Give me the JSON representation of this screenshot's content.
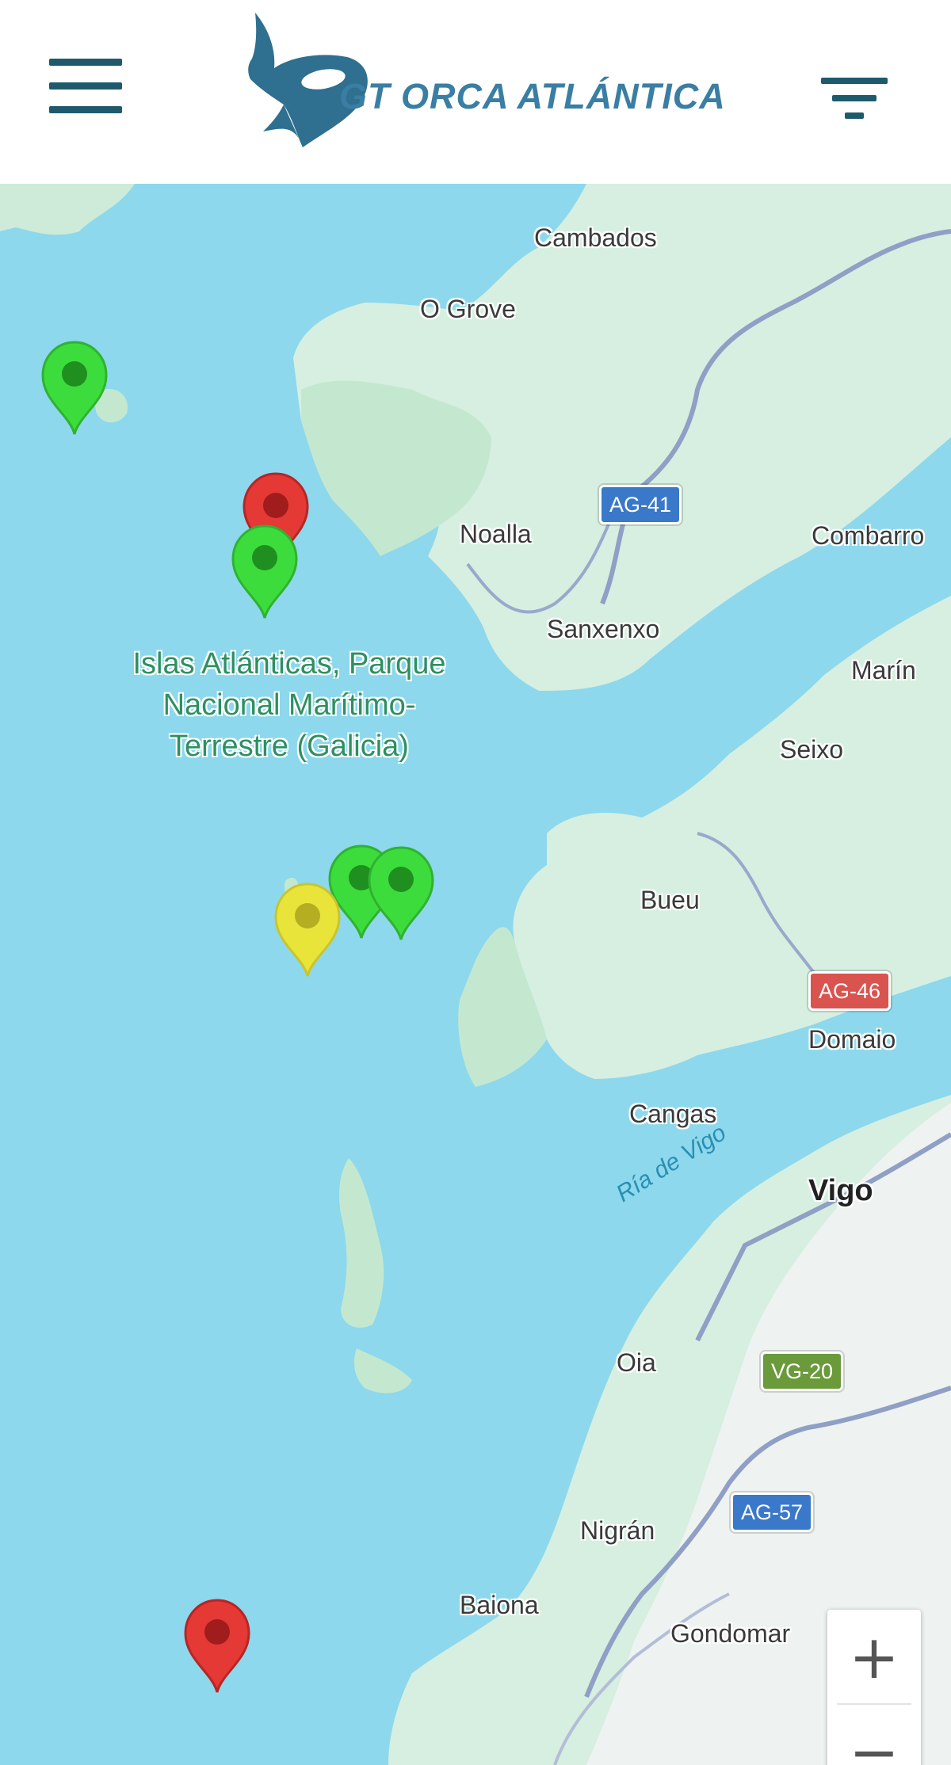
{
  "header": {
    "brand": "GT ORCA ATLÁNTICA",
    "menu_icon": "hamburger-menu-icon",
    "filter_icon": "filter-icon",
    "brand_color": "#2f6f8f"
  },
  "map": {
    "places": [
      {
        "name": "Cambados"
      },
      {
        "name": "O Grove"
      },
      {
        "name": "Noalla"
      },
      {
        "name": "Combarro"
      },
      {
        "name": "Sanxenxo"
      },
      {
        "name": "Marín"
      },
      {
        "name": "Seixo"
      },
      {
        "name": "Bueu"
      },
      {
        "name": "Domaio"
      },
      {
        "name": "Cangas"
      },
      {
        "name": "Vigo"
      },
      {
        "name": "Oia"
      },
      {
        "name": "Nigrán"
      },
      {
        "name": "Baiona"
      },
      {
        "name": "Gondomar"
      }
    ],
    "park_label": "Islas Atlánticas, Parque Nacional Marítimo-Terrestre (Galicia)",
    "water_label": "Ría de Vigo",
    "road_shields": [
      {
        "ref": "AG-41",
        "color": "#3a78c9"
      },
      {
        "ref": "AG-46",
        "color": "#d9534f"
      },
      {
        "ref": "VG-20",
        "color": "#6a9a3a"
      },
      {
        "ref": "AG-57",
        "color": "#3a78c9"
      }
    ],
    "markers": [
      {
        "status": "green",
        "color": "#3ddc3d"
      },
      {
        "status": "red",
        "color": "#e53935"
      },
      {
        "status": "green",
        "color": "#3ddc3d"
      },
      {
        "status": "green",
        "color": "#3ddc3d"
      },
      {
        "status": "green",
        "color": "#3ddc3d"
      },
      {
        "status": "yellow",
        "color": "#e8e43a"
      },
      {
        "status": "red",
        "color": "#e53935"
      }
    ],
    "zoom": {
      "in_label": "+",
      "out_label": "−"
    }
  }
}
